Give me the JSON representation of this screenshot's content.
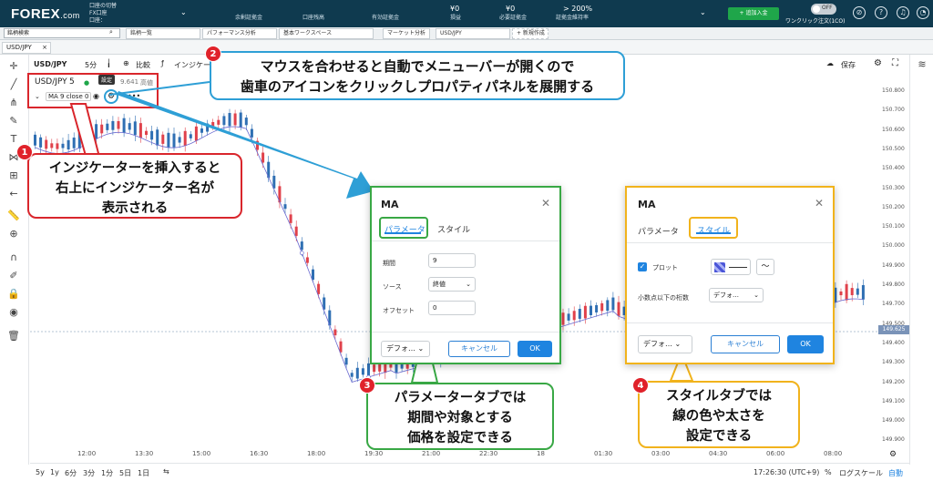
{
  "header": {
    "logo": "FOREX",
    "logo_suffix": ".com",
    "account_lines": [
      "口座の切替",
      "FX口座",
      "口座："
    ],
    "stats": [
      {
        "label": "余剰証拠金",
        "value": ""
      },
      {
        "label": "口座残高",
        "value": ""
      },
      {
        "label": "有効証拠金",
        "value": ""
      },
      {
        "label": "損益",
        "value": "¥0"
      },
      {
        "label": "必要証拠金",
        "value": "¥0"
      },
      {
        "label": "証拠金維持率",
        "value": "> 200%"
      }
    ],
    "deposit_label": "+ 追加入金",
    "oneclick_label": "ワンクリック注文(1CO)",
    "toggle_label": "OFF"
  },
  "nav": {
    "search_placeholder": "銘柄検索",
    "tabs": [
      "銘柄一覧",
      "パフォーマンス分析",
      "基本ワークスペース",
      "マーケット分析",
      "USD/JPY",
      "+ 新規作成"
    ]
  },
  "chart_tab": "USD/JPY",
  "toolbar": {
    "symbol": "USD/JPY",
    "interval": "5分",
    "compare": "比較",
    "indicator": "インジケー",
    "save": "保存"
  },
  "legend": {
    "symbol": "USD/JPY",
    "interval": "5",
    "price_fragment": "9.641",
    "high_label": "高値",
    "ma_label": "MA 9 close 0",
    "tooltip": "設定"
  },
  "y_axis": [
    "150.800",
    "150.700",
    "150.600",
    "150.500",
    "150.400",
    "150.300",
    "150.200",
    "150.100",
    "150.000",
    "149.900",
    "149.800",
    "149.700",
    "149.500",
    "149.400",
    "149.300",
    "149.200",
    "149.100",
    "149.000",
    "149.900"
  ],
  "current_price": "149.625",
  "x_axis": [
    "12:00",
    "13:30",
    "15:00",
    "16:30",
    "18:00",
    "19:30",
    "21:00",
    "22:30",
    "18",
    "01:30",
    "03:00",
    "04:30",
    "06:00",
    "08:00"
  ],
  "bottom": {
    "ranges": [
      "5y",
      "1y",
      "6分",
      "3分",
      "1分",
      "5日",
      "1日"
    ],
    "clock": "17:26:30 (UTC+9)",
    "percent": "%",
    "log": "ログスケール",
    "auto": "自動"
  },
  "callouts": {
    "c1": [
      "インジケーターを挿入すると",
      "右上にインジケーター名が",
      "表示される"
    ],
    "c2": [
      "マウスを合わせると自動でメニューバーが開くので",
      "歯車のアイコンをクリックしプロパティパネルを展開する"
    ],
    "c3": [
      "パラメータータブでは",
      "期間や対象とする",
      "価格を設定できる"
    ],
    "c4": [
      "スタイルタブでは",
      "線の色や太さを",
      "設定できる"
    ],
    "badges": [
      "1",
      "2",
      "3",
      "4"
    ]
  },
  "dialog_param": {
    "title": "MA",
    "tab_param": "パラメータ",
    "tab_style": "スタイル",
    "period_label": "期間",
    "period_value": "9",
    "source_label": "ソース",
    "source_value": "終値",
    "offset_label": "オフセット",
    "offset_value": "0",
    "default_btn": "デフォ…",
    "cancel_btn": "キャンセル",
    "ok_btn": "OK"
  },
  "dialog_style": {
    "title": "MA",
    "tab_param": "パラメータ",
    "tab_style": "スタイル",
    "plot_label": "プロット",
    "decimals_label": "小数点以下の桁数",
    "decimals_value": "デフォ…",
    "default_btn": "デフォ…",
    "cancel_btn": "キャンセル",
    "ok_btn": "OK"
  },
  "colors": {
    "header": "#0f3a4f",
    "red": "#d9262c",
    "blue": "#2e9fd6",
    "green": "#39a845",
    "yellow": "#f1b31c",
    "up": "#e0414b",
    "down": "#2f6fb3",
    "ma": "#6a6ad0"
  }
}
